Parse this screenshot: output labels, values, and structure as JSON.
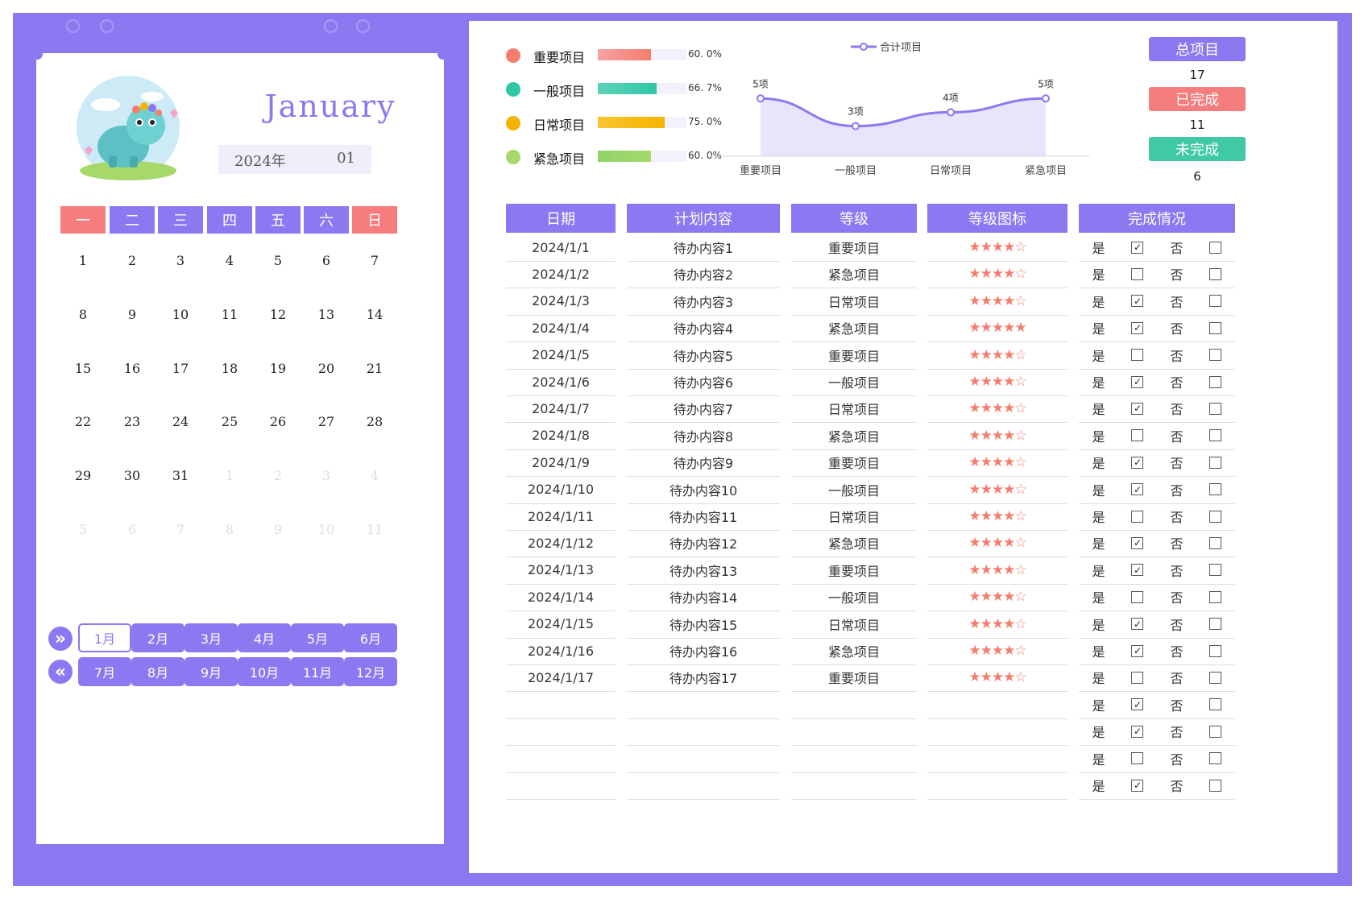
{
  "calendar": {
    "month_name": "January",
    "year_label": "2024年",
    "month_number": "01",
    "weekdays": [
      "一",
      "二",
      "三",
      "四",
      "五",
      "六",
      "日"
    ],
    "weeks": [
      [
        "1",
        "2",
        "3",
        "4",
        "5",
        "6",
        "7"
      ],
      [
        "8",
        "9",
        "10",
        "11",
        "12",
        "13",
        "14"
      ],
      [
        "15",
        "16",
        "17",
        "18",
        "19",
        "20",
        "21"
      ],
      [
        "22",
        "23",
        "24",
        "25",
        "26",
        "27",
        "28"
      ],
      [
        "29",
        "30",
        "31",
        "1",
        "2",
        "3",
        "4"
      ],
      [
        "5",
        "6",
        "7",
        "8",
        "9",
        "10",
        "11"
      ]
    ],
    "months_row1": [
      "1月",
      "2月",
      "3月",
      "4月",
      "5月",
      "6月"
    ],
    "months_row2": [
      "7月",
      "8月",
      "9月",
      "10月",
      "11月",
      "12月"
    ],
    "selected_month": "1月",
    "next_icon": "double-chevron-right-icon",
    "prev_icon": "double-chevron-left-icon"
  },
  "categories": [
    {
      "label": "重要项目",
      "pct_text": "60. 0%",
      "pct": 0.6,
      "color": "#f57d6e",
      "bar_color": "#f5a3a3"
    },
    {
      "label": "一般项目",
      "pct_text": "66. 7%",
      "pct": 0.667,
      "color": "#2ec7a6",
      "bar_color": "#5fd1b8"
    },
    {
      "label": "日常项目",
      "pct_text": "75. 0%",
      "pct": 0.75,
      "color": "#f5b400",
      "bar_color": "#f7c531"
    },
    {
      "label": "紧急项目",
      "pct_text": "60. 0%",
      "pct": 0.6,
      "color": "#a6d96a",
      "bar_color": "#8fd46a"
    }
  ],
  "chart_data": {
    "type": "area",
    "legend": "合计项目",
    "legend_position": "top",
    "categories": [
      "重要项目",
      "一般项目",
      "日常项目",
      "紧急项目"
    ],
    "series": [
      {
        "name": "合计项目",
        "values": [
          5,
          3,
          4,
          5
        ]
      }
    ],
    "data_labels": [
      "5项",
      "3项",
      "4项",
      "5项"
    ],
    "ylim": [
      0,
      7
    ],
    "grid": false
  },
  "summary": {
    "total_label": "总项目",
    "total_value": "17",
    "done_label": "已完成",
    "done_value": "11",
    "undone_label": "未完成",
    "undone_value": "6"
  },
  "table": {
    "headers": [
      "日期",
      "计划内容",
      "等级",
      "等级图标",
      "完成情况"
    ],
    "yes_label": "是",
    "no_label": "否",
    "rows": [
      {
        "date": "2024/1/1",
        "task": "待办内容1",
        "level": "重要项目",
        "stars": "★★★★☆",
        "done": true,
        "not_done": false
      },
      {
        "date": "2024/1/2",
        "task": "待办内容2",
        "level": "紧急项目",
        "stars": "★★★★☆",
        "done": false,
        "not_done": false
      },
      {
        "date": "2024/1/3",
        "task": "待办内容3",
        "level": "日常项目",
        "stars": "★★★★☆",
        "done": true,
        "not_done": false
      },
      {
        "date": "2024/1/4",
        "task": "待办内容4",
        "level": "紧急项目",
        "stars": "★★★★★",
        "done": true,
        "not_done": false
      },
      {
        "date": "2024/1/5",
        "task": "待办内容5",
        "level": "重要项目",
        "stars": "★★★★☆",
        "done": false,
        "not_done": false
      },
      {
        "date": "2024/1/6",
        "task": "待办内容6",
        "level": "一般项目",
        "stars": "★★★★☆",
        "done": true,
        "not_done": false
      },
      {
        "date": "2024/1/7",
        "task": "待办内容7",
        "level": "日常项目",
        "stars": "★★★★☆",
        "done": true,
        "not_done": false
      },
      {
        "date": "2024/1/8",
        "task": "待办内容8",
        "level": "紧急项目",
        "stars": "★★★★☆",
        "done": false,
        "not_done": false
      },
      {
        "date": "2024/1/9",
        "task": "待办内容9",
        "level": "重要项目",
        "stars": "★★★★☆",
        "done": true,
        "not_done": false
      },
      {
        "date": "2024/1/10",
        "task": "待办内容10",
        "level": "一般项目",
        "stars": "★★★★☆",
        "done": true,
        "not_done": false
      },
      {
        "date": "2024/1/11",
        "task": "待办内容11",
        "level": "日常项目",
        "stars": "★★★★☆",
        "done": false,
        "not_done": false
      },
      {
        "date": "2024/1/12",
        "task": "待办内容12",
        "level": "紧急项目",
        "stars": "★★★★☆",
        "done": true,
        "not_done": false
      },
      {
        "date": "2024/1/13",
        "task": "待办内容13",
        "level": "重要项目",
        "stars": "★★★★☆",
        "done": true,
        "not_done": false
      },
      {
        "date": "2024/1/14",
        "task": "待办内容14",
        "level": "一般项目",
        "stars": "★★★★☆",
        "done": false,
        "not_done": false
      },
      {
        "date": "2024/1/15",
        "task": "待办内容15",
        "level": "日常项目",
        "stars": "★★★★☆",
        "done": true,
        "not_done": false
      },
      {
        "date": "2024/1/16",
        "task": "待办内容16",
        "level": "紧急项目",
        "stars": "★★★★☆",
        "done": true,
        "not_done": false
      },
      {
        "date": "2024/1/17",
        "task": "待办内容17",
        "level": "重要项目",
        "stars": "★★★★☆",
        "done": false,
        "not_done": false
      },
      {
        "date": "",
        "task": "",
        "level": "",
        "stars": "",
        "done": true,
        "not_done": false
      },
      {
        "date": "",
        "task": "",
        "level": "",
        "stars": "",
        "done": true,
        "not_done": false
      },
      {
        "date": "",
        "task": "",
        "level": "",
        "stars": "",
        "done": false,
        "not_done": false
      },
      {
        "date": "",
        "task": "",
        "level": "",
        "stars": "",
        "done": true,
        "not_done": false
      }
    ]
  },
  "theme": {
    "primary": "#8b79f2",
    "weekend": "#f57d7d",
    "done": "#f57d7d",
    "undone": "#3fc9a5"
  }
}
